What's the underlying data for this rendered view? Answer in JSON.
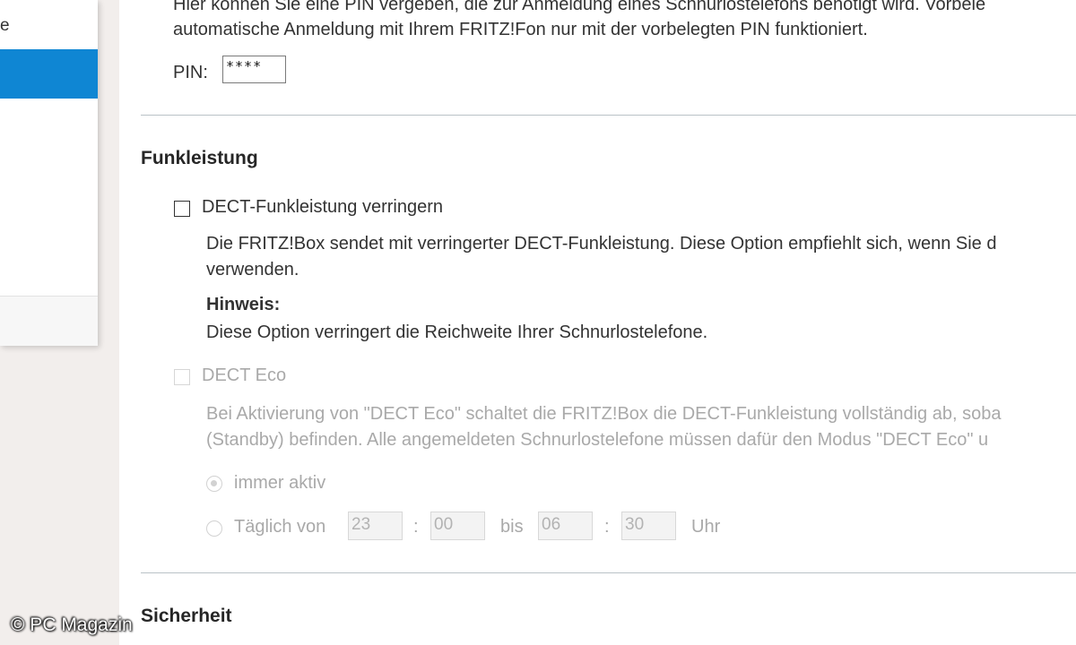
{
  "sidebar": {
    "item_1_partial": "e"
  },
  "pin_section": {
    "line_1": "Hier können Sie eine PIN vergeben, die zur Anmeldung eines Schnurlostelefons benötigt wird. Vorbele",
    "line_2": "automatische Anmeldung mit Ihrem FRITZ!Fon nur mit der vorbelegten PIN funktioniert.",
    "pin_label": "PIN:",
    "pin_value": "****"
  },
  "funkleistung": {
    "heading": "Funkleistung",
    "option_label": "DECT-Funkleistung verringern",
    "option_checked": false,
    "desc_line_1": "Die FRITZ!Box sendet mit verringerter DECT-Funkleistung. Diese Option empfiehlt sich, wenn Sie d",
    "desc_line_2": "verwenden.",
    "hint_title": "Hinweis:",
    "hint_text": "Diese Option verringert die Reichweite Ihrer Schnurlostelefone."
  },
  "dect_eco": {
    "option_label": "DECT Eco",
    "option_checked": false,
    "desc_line_1": "Bei Aktivierung von \"DECT Eco\" schaltet die FRITZ!Box die DECT-Funkleistung vollständig ab, soba",
    "desc_line_2": "(Standby) befinden. Alle angemeldeten Schnurlostelefone müssen dafür den Modus \"DECT Eco\" u",
    "radio_always": "immer aktiv",
    "radio_daily": "Täglich von",
    "from_hour": "23",
    "colon_1": ":",
    "from_minute": "00",
    "bis_label": "bis",
    "to_hour": "06",
    "colon_2": ":",
    "to_minute": "30",
    "uhr_label": "Uhr"
  },
  "sicherheit": {
    "heading": "Sicherheit"
  },
  "watermark": "© PC Magazin",
  "colors": {
    "accent_blue": "#0f86d3",
    "divider": "#b9c2c6",
    "disabled_text": "#a9a9a9"
  }
}
